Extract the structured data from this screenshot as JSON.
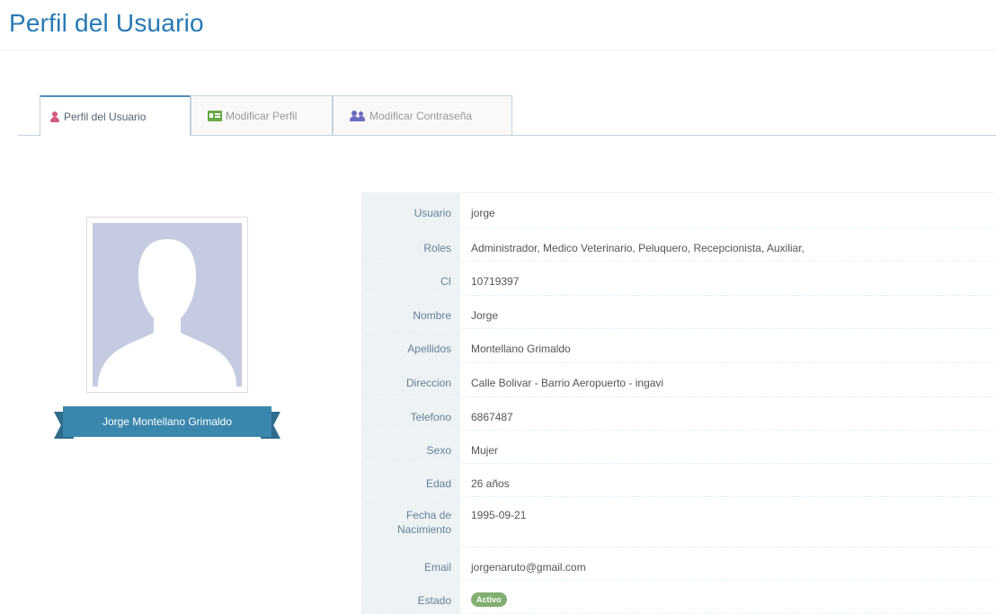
{
  "page": {
    "title": "Perfil del Usuario"
  },
  "tabs": [
    {
      "label": "Perfil del Usuario",
      "icon": "user-icon",
      "active": true
    },
    {
      "label": "Modificar Perfil",
      "icon": "id-card-icon",
      "active": false
    },
    {
      "label": "Modificar Contraseña",
      "icon": "users-icon",
      "active": false
    }
  ],
  "profile": {
    "full_name": "Jorge Montellano Grimaldo",
    "fields": [
      {
        "label": "Usuario",
        "value": "jorge"
      },
      {
        "label": "Roles",
        "value": "Administrador, Medico Veterinario, Peluquero, Recepcionista, Auxiliar,"
      },
      {
        "label": "CI",
        "value": "10719397"
      },
      {
        "label": "Nombre",
        "value": "Jorge"
      },
      {
        "label": "Apellidos",
        "value": "Montellano Grimaldo"
      },
      {
        "label": "Direccion",
        "value": "Calle Bolivar - Barrio Aeropuerto - ingavi"
      },
      {
        "label": "Telefono",
        "value": "6867487"
      },
      {
        "label": "Sexo",
        "value": "Mujer"
      },
      {
        "label": "Edad",
        "value": "26 años"
      },
      {
        "label": "Fecha de Nacimiento",
        "value": "1995-09-21"
      },
      {
        "label": "Email",
        "value": "jorgenaruto@gmail.com"
      },
      {
        "label": "Estado",
        "value": "Activo",
        "badge_color": "#82af6f"
      }
    ]
  },
  "colors": {
    "title": "#2679b5",
    "ribbon": "#3a87ad",
    "label_bg": "#edf3f4",
    "avatar_bg": "#c5cce2"
  }
}
